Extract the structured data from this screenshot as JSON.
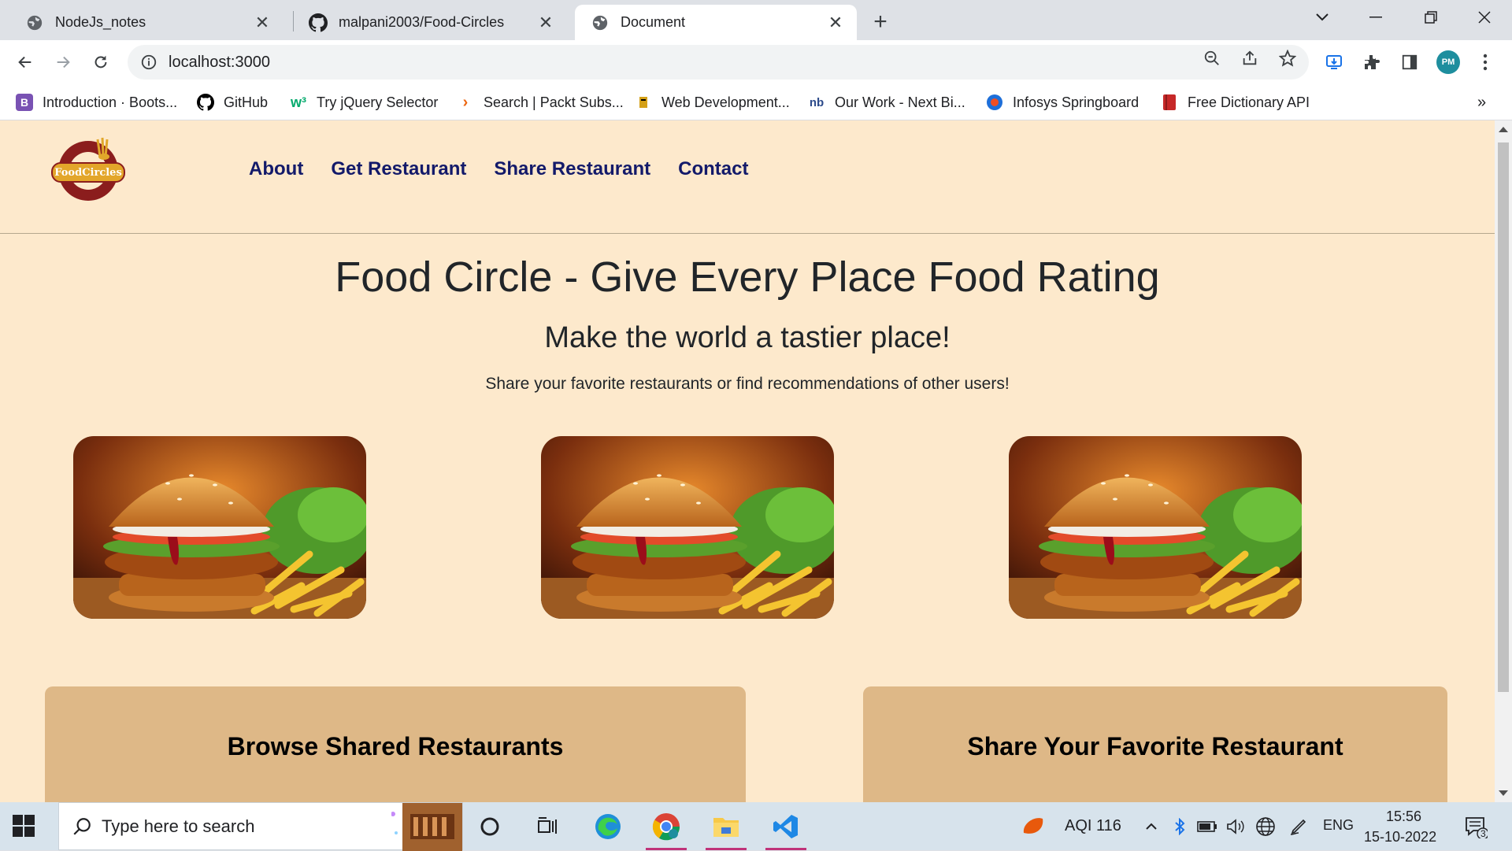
{
  "browser": {
    "tabs": [
      {
        "title": "NodeJs_notes",
        "icon": "globe-icon",
        "active": false
      },
      {
        "title": "malpani2003/Food-Circles",
        "icon": "github-icon",
        "active": false
      },
      {
        "title": "Document",
        "icon": "globe-icon",
        "active": true
      }
    ],
    "address": "localhost:3000",
    "bookmarks": [
      {
        "label": "Introduction · Boots...",
        "icon": "bootstrap-icon",
        "color": "#7952b3"
      },
      {
        "label": "GitHub",
        "icon": "github-icon",
        "color": "#000000"
      },
      {
        "label": "Try jQuery Selector",
        "icon": "w3schools-icon",
        "color": "#04aa6d"
      },
      {
        "label": "Search | Packt Subs...",
        "icon": "packt-icon",
        "color": "#ec6611"
      },
      {
        "label": "Web Development...",
        "icon": "web-dev-icon",
        "color": "#d4a017"
      },
      {
        "label": "Our Work - Next Bi...",
        "icon": "nextbi-icon",
        "color": "#2c4a8a"
      },
      {
        "label": "Infosys Springboard",
        "icon": "infosys-icon",
        "color": "#1e6fd9"
      },
      {
        "label": "Free Dictionary API",
        "icon": "dictionary-icon",
        "color": "#c62828"
      }
    ]
  },
  "site": {
    "logo_text": "FoodCircles",
    "nav": [
      "About",
      "Get Restaurant",
      "Share Restaurant",
      "Contact"
    ],
    "hero_title": "Food Circle - Give Every Place Food Rating",
    "hero_subtitle": "Make the world a tastier place!",
    "hero_text": "Share your favorite restaurants or find recommendations of other users!",
    "cards": [
      {
        "title": "Browse Shared Restaurants"
      },
      {
        "title": "Share Your Favorite Restaurant"
      }
    ],
    "colors": {
      "background": "#fde9cc",
      "nav_link": "#131a6a",
      "card": "#deb887"
    }
  },
  "taskbar": {
    "search_placeholder": "Type here to search",
    "aqi": "AQI 116",
    "language": "ENG",
    "time": "15:56",
    "date": "15-10-2022",
    "notification_count": "3"
  }
}
